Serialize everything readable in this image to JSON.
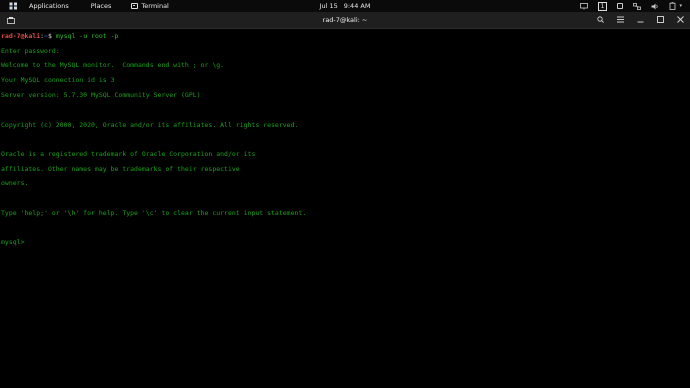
{
  "topbar": {
    "applications": "Applications",
    "places": "Places",
    "terminal": "Terminal",
    "date": "Jul 15",
    "time": "9:44 AM",
    "workspace": "1"
  },
  "window": {
    "title": "rad-7@kali: ~"
  },
  "terminal": {
    "prompt_user": "rad-7@kali",
    "prompt_sep": ":",
    "prompt_path": "~",
    "prompt_symbol": "$",
    "command": " mysql -u root -p",
    "output": [
      "Enter password:",
      "Welcome to the MySQL monitor.  Commands end with ; or \\g.",
      "Your MySQL connection id is 3",
      "Server version: 5.7.30 MySQL Community Server (GPL)",
      "Copyright (c) 2000, 2020, Oracle and/or its affiliates. All rights reserved.",
      "Oracle is a registered trademark of Oracle Corporation and/or its",
      "affiliates. Other names may be trademarks of their respective",
      "owners.",
      "Type 'help;' or '\\h' for help. Type '\\c' to clear the current input statement.",
      "mysql>"
    ]
  }
}
